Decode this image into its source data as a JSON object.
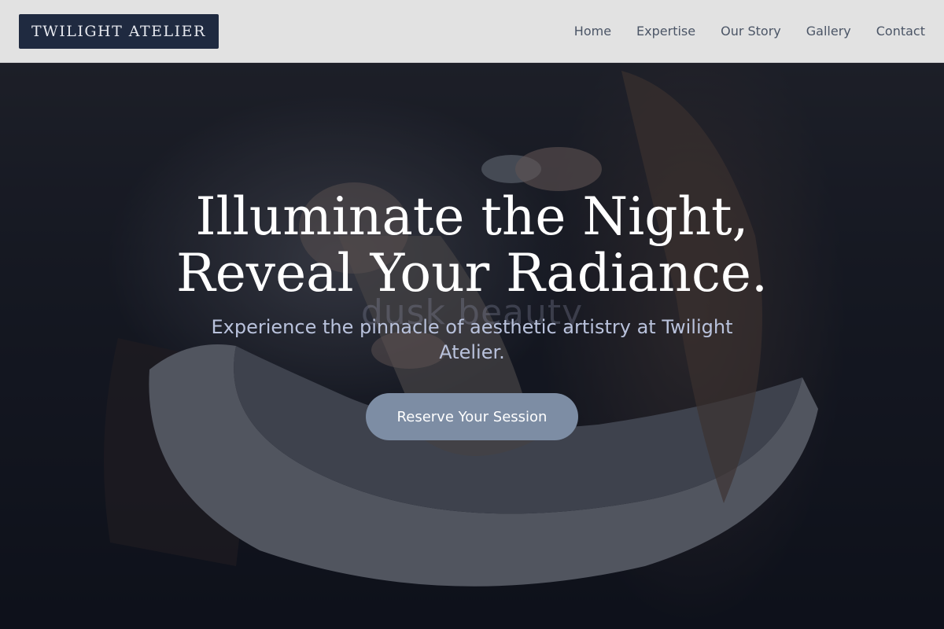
{
  "header": {
    "logo_text": "TWILIGHT ATELIER",
    "nav": [
      {
        "label": "Home"
      },
      {
        "label": "Expertise"
      },
      {
        "label": "Our Story"
      },
      {
        "label": "Gallery"
      },
      {
        "label": "Contact"
      }
    ]
  },
  "hero": {
    "headline_line1": "Illuminate the Night,",
    "headline_line2": "Reveal Your Radiance.",
    "subheadline": "Experience the pinnacle of aesthetic artistry at Twilight Atelier.",
    "watermark": "dusk beauty",
    "cta_label": "Reserve Your Session",
    "background_image": "hair-wash-salon-photo"
  },
  "colors": {
    "logo_bg": "#1f2a40",
    "nav_text": "#4b5566",
    "cta_bg": "#7d8da4",
    "subheadline": "#b9c2dc"
  }
}
